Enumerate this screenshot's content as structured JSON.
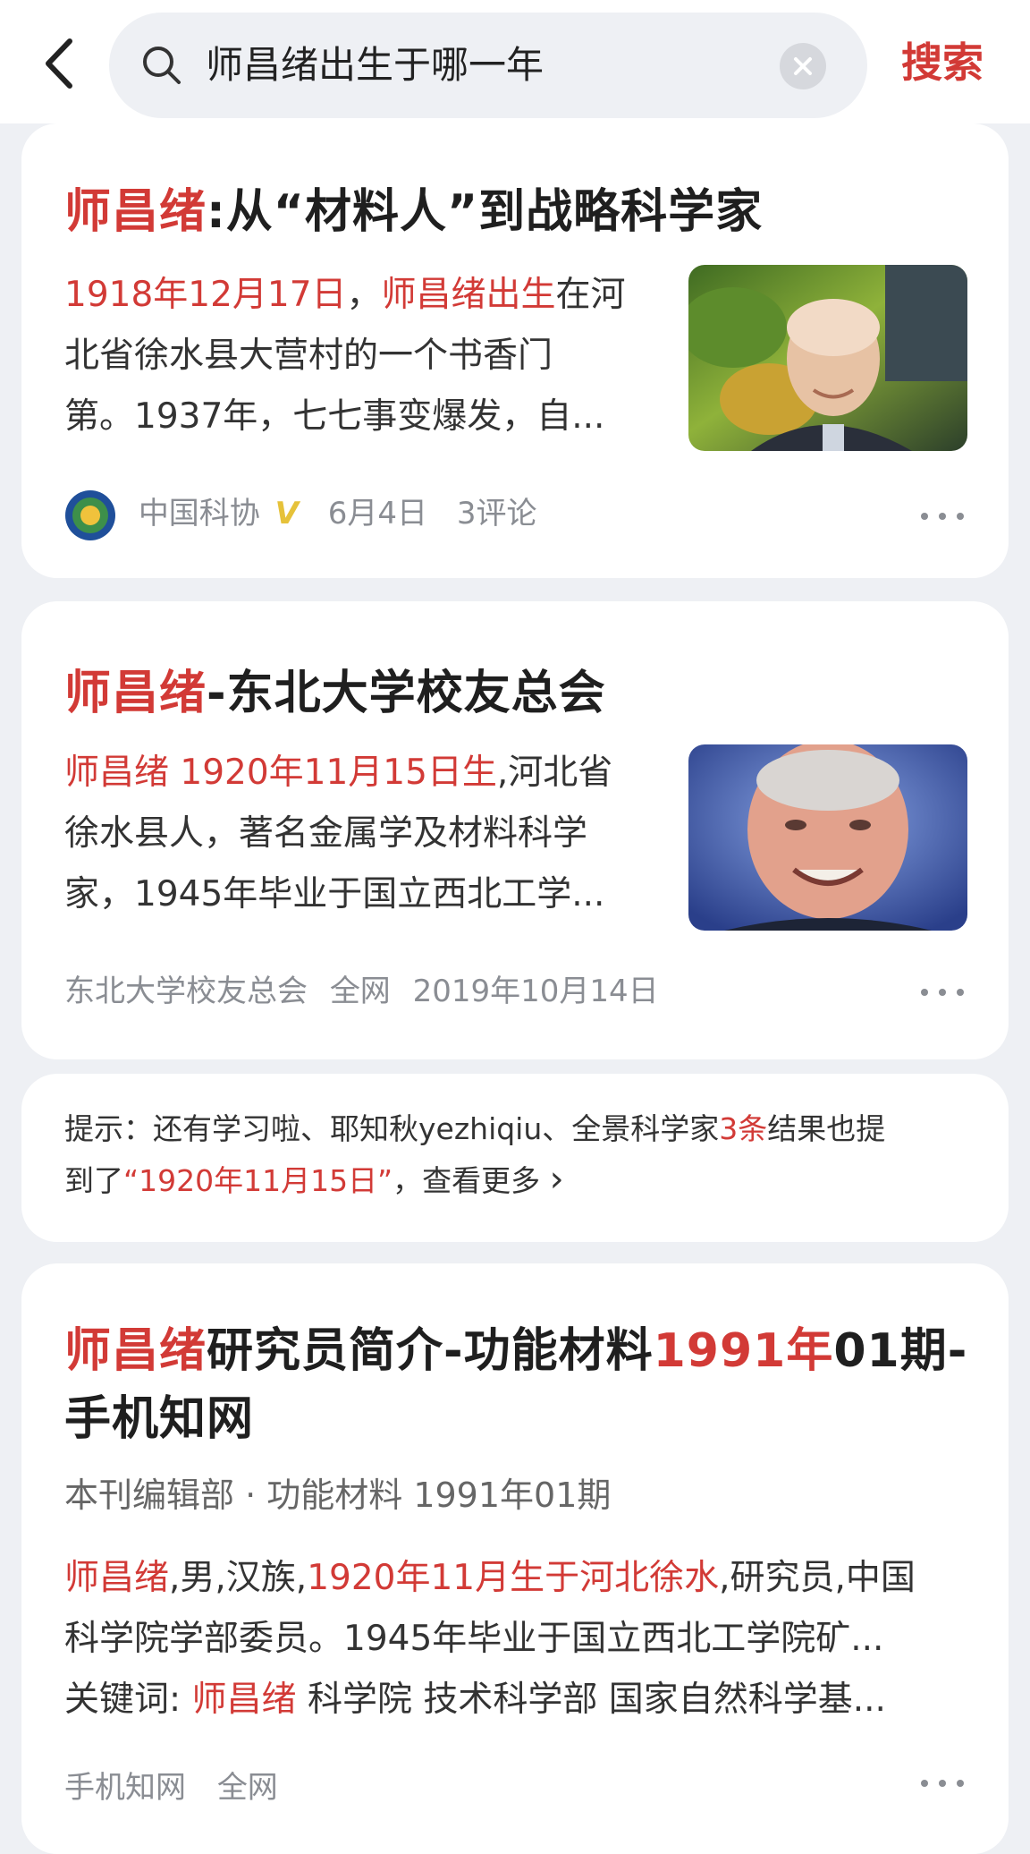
{
  "search": {
    "query": "师昌绪出生于哪一年",
    "button": "搜索"
  },
  "results": [
    {
      "title": {
        "highlight": "师昌绪",
        "rest": ":从“材料人”到战略科学家"
      },
      "snippet": {
        "line1_h1": "1918年12月17日",
        "line1_sep": "，",
        "line1_h2": "师昌绪出生",
        "line1_rest": "在河",
        "line2": "北省徐水县大营村的一个书香门",
        "line3": "第。1937年，七七事变爆发，自..."
      },
      "source": "中国科协",
      "verified_badge": "V",
      "date": "6月4日",
      "comments": "3评论"
    },
    {
      "title": {
        "highlight": "师昌绪",
        "rest": "-东北大学校友总会"
      },
      "snippet": {
        "line1_h": "师昌绪 1920年11月15日生",
        "line1_rest": ",河北省",
        "line2": "徐水县人，著名金属学及材料科学",
        "line3": "家，1945年毕业于国立西北工学..."
      },
      "source": "东北大学校友总会",
      "scope": "全网",
      "date": "2019年10月14日"
    },
    {
      "title": {
        "h1": "师昌绪",
        "mid": "研究员简介-功能材料",
        "h2": "1991年",
        "rest": "01期-",
        "line2": "手机知网"
      },
      "byline": "本刊编辑部 · 功能材料 1991年01期",
      "snippet": {
        "line1_h1": "师昌绪",
        "line1_mid": ",男,汉族,",
        "line1_h2": "1920年11月生于河北徐水",
        "line1_rest": ",研究员,中国",
        "line2": "科学院学部委员。1945年毕业于国立西北工学院矿...",
        "kw_label": "关键词: ",
        "kw_h": "师昌绪",
        "kw_rest": " 科学院 技术科学部 国家自然科学基..."
      },
      "source": "手机知网",
      "scope": "全网"
    }
  ],
  "tip": {
    "prefix": "提示：还有学习啦、耶知秋yezhiqiu、全景科学家",
    "count": "3条",
    "middle": "结果也提",
    "line2_a": "到了",
    "line2_h": "“1920年11月15日”",
    "line2_b": "，查看更多",
    "arrow": "›"
  },
  "colors": {
    "accent": "#d23a36",
    "meta": "#8a8d93",
    "background": "#eef0f4"
  },
  "icons": [
    "back-arrow-icon",
    "search-icon",
    "clear-icon",
    "more-icon",
    "verified-icon",
    "cast-logo-icon"
  ]
}
